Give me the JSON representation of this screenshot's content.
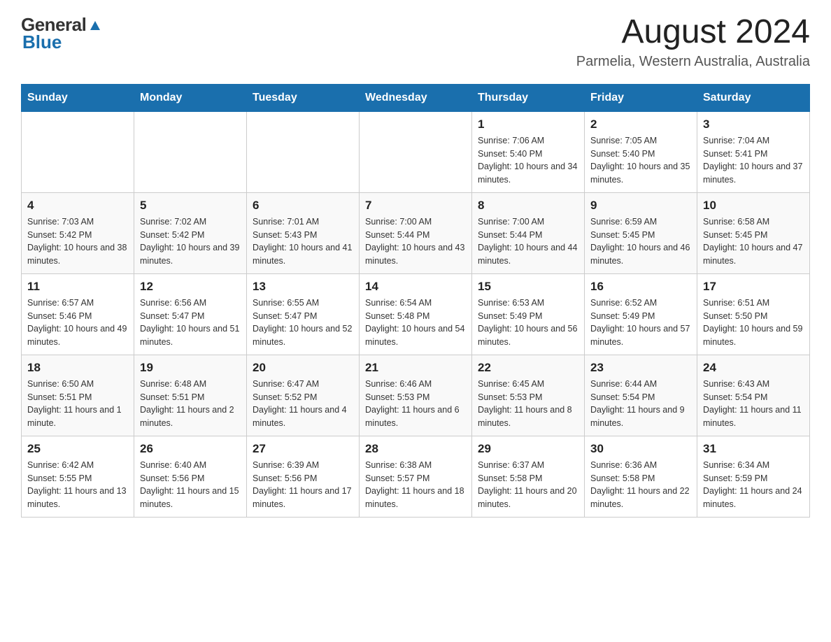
{
  "logo": {
    "general": "General",
    "blue": "Blue"
  },
  "title": "August 2024",
  "subtitle": "Parmelia, Western Australia, Australia",
  "days_of_week": [
    "Sunday",
    "Monday",
    "Tuesday",
    "Wednesday",
    "Thursday",
    "Friday",
    "Saturday"
  ],
  "weeks": [
    [
      {
        "day": "",
        "info": ""
      },
      {
        "day": "",
        "info": ""
      },
      {
        "day": "",
        "info": ""
      },
      {
        "day": "",
        "info": ""
      },
      {
        "day": "1",
        "info": "Sunrise: 7:06 AM\nSunset: 5:40 PM\nDaylight: 10 hours and 34 minutes."
      },
      {
        "day": "2",
        "info": "Sunrise: 7:05 AM\nSunset: 5:40 PM\nDaylight: 10 hours and 35 minutes."
      },
      {
        "day": "3",
        "info": "Sunrise: 7:04 AM\nSunset: 5:41 PM\nDaylight: 10 hours and 37 minutes."
      }
    ],
    [
      {
        "day": "4",
        "info": "Sunrise: 7:03 AM\nSunset: 5:42 PM\nDaylight: 10 hours and 38 minutes."
      },
      {
        "day": "5",
        "info": "Sunrise: 7:02 AM\nSunset: 5:42 PM\nDaylight: 10 hours and 39 minutes."
      },
      {
        "day": "6",
        "info": "Sunrise: 7:01 AM\nSunset: 5:43 PM\nDaylight: 10 hours and 41 minutes."
      },
      {
        "day": "7",
        "info": "Sunrise: 7:00 AM\nSunset: 5:44 PM\nDaylight: 10 hours and 43 minutes."
      },
      {
        "day": "8",
        "info": "Sunrise: 7:00 AM\nSunset: 5:44 PM\nDaylight: 10 hours and 44 minutes."
      },
      {
        "day": "9",
        "info": "Sunrise: 6:59 AM\nSunset: 5:45 PM\nDaylight: 10 hours and 46 minutes."
      },
      {
        "day": "10",
        "info": "Sunrise: 6:58 AM\nSunset: 5:45 PM\nDaylight: 10 hours and 47 minutes."
      }
    ],
    [
      {
        "day": "11",
        "info": "Sunrise: 6:57 AM\nSunset: 5:46 PM\nDaylight: 10 hours and 49 minutes."
      },
      {
        "day": "12",
        "info": "Sunrise: 6:56 AM\nSunset: 5:47 PM\nDaylight: 10 hours and 51 minutes."
      },
      {
        "day": "13",
        "info": "Sunrise: 6:55 AM\nSunset: 5:47 PM\nDaylight: 10 hours and 52 minutes."
      },
      {
        "day": "14",
        "info": "Sunrise: 6:54 AM\nSunset: 5:48 PM\nDaylight: 10 hours and 54 minutes."
      },
      {
        "day": "15",
        "info": "Sunrise: 6:53 AM\nSunset: 5:49 PM\nDaylight: 10 hours and 56 minutes."
      },
      {
        "day": "16",
        "info": "Sunrise: 6:52 AM\nSunset: 5:49 PM\nDaylight: 10 hours and 57 minutes."
      },
      {
        "day": "17",
        "info": "Sunrise: 6:51 AM\nSunset: 5:50 PM\nDaylight: 10 hours and 59 minutes."
      }
    ],
    [
      {
        "day": "18",
        "info": "Sunrise: 6:50 AM\nSunset: 5:51 PM\nDaylight: 11 hours and 1 minute."
      },
      {
        "day": "19",
        "info": "Sunrise: 6:48 AM\nSunset: 5:51 PM\nDaylight: 11 hours and 2 minutes."
      },
      {
        "day": "20",
        "info": "Sunrise: 6:47 AM\nSunset: 5:52 PM\nDaylight: 11 hours and 4 minutes."
      },
      {
        "day": "21",
        "info": "Sunrise: 6:46 AM\nSunset: 5:53 PM\nDaylight: 11 hours and 6 minutes."
      },
      {
        "day": "22",
        "info": "Sunrise: 6:45 AM\nSunset: 5:53 PM\nDaylight: 11 hours and 8 minutes."
      },
      {
        "day": "23",
        "info": "Sunrise: 6:44 AM\nSunset: 5:54 PM\nDaylight: 11 hours and 9 minutes."
      },
      {
        "day": "24",
        "info": "Sunrise: 6:43 AM\nSunset: 5:54 PM\nDaylight: 11 hours and 11 minutes."
      }
    ],
    [
      {
        "day": "25",
        "info": "Sunrise: 6:42 AM\nSunset: 5:55 PM\nDaylight: 11 hours and 13 minutes."
      },
      {
        "day": "26",
        "info": "Sunrise: 6:40 AM\nSunset: 5:56 PM\nDaylight: 11 hours and 15 minutes."
      },
      {
        "day": "27",
        "info": "Sunrise: 6:39 AM\nSunset: 5:56 PM\nDaylight: 11 hours and 17 minutes."
      },
      {
        "day": "28",
        "info": "Sunrise: 6:38 AM\nSunset: 5:57 PM\nDaylight: 11 hours and 18 minutes."
      },
      {
        "day": "29",
        "info": "Sunrise: 6:37 AM\nSunset: 5:58 PM\nDaylight: 11 hours and 20 minutes."
      },
      {
        "day": "30",
        "info": "Sunrise: 6:36 AM\nSunset: 5:58 PM\nDaylight: 11 hours and 22 minutes."
      },
      {
        "day": "31",
        "info": "Sunrise: 6:34 AM\nSunset: 5:59 PM\nDaylight: 11 hours and 24 minutes."
      }
    ]
  ]
}
